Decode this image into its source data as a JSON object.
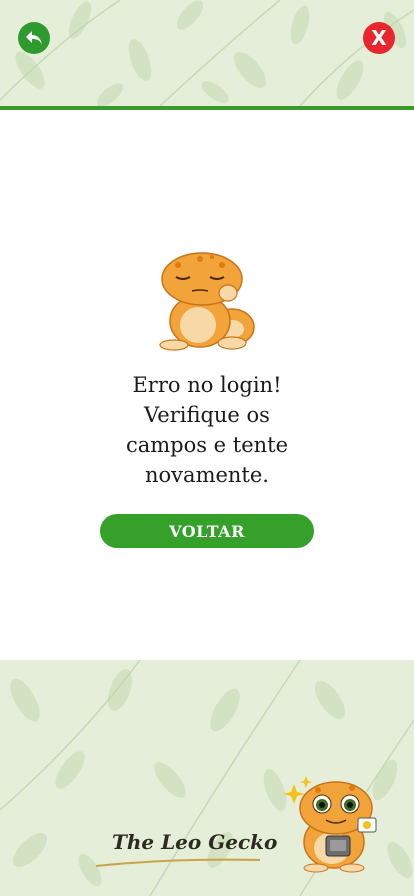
{
  "header": {
    "back_icon": "back-arrow-icon",
    "close_icon": "close-x-icon",
    "close_glyph": "X"
  },
  "message": {
    "lines": [
      "Erro no login!",
      "Verifique os",
      "campos e tente",
      "novamente."
    ]
  },
  "actions": {
    "back_label": "VOLTAR"
  },
  "footer": {
    "brand_name": "The Leo Gecko"
  },
  "colors": {
    "accent_green": "#35a02a",
    "close_red": "#e8262d",
    "banner_bg": "#e5eed8",
    "gecko_orange": "#f0a030"
  }
}
